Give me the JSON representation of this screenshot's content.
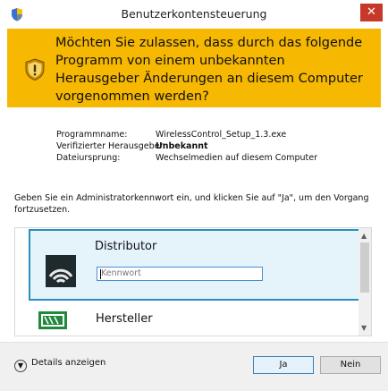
{
  "window": {
    "title": "Benutzerkontensteuerung",
    "close_glyph": "✕",
    "title_icon": "shield-icon"
  },
  "banner": {
    "text": "Möchten Sie zulassen, dass durch das folgende Programm von einem unbekannten Herausgeber Änderungen an diesem Computer vorgenommen werden?",
    "icon": "warning-shield-icon",
    "color": "#f6b800"
  },
  "details": {
    "program_label": "Programmname:",
    "program_value": "WirelessControl_Setup_1.3.exe",
    "publisher_label": "Verifizierter Herausgeber:",
    "publisher_value": "Unbekannt",
    "origin_label": "Dateiursprung:",
    "origin_value": "Wechselmedien auf diesem Computer"
  },
  "prompt": "Geben Sie ein Administratorkennwort ein, und klicken Sie auf \"Ja\", um den Vorgang fortzusetzen.",
  "accounts": {
    "selected": {
      "name": "Distributor",
      "password_placeholder": "Kennwort",
      "icon": "wifi-icon"
    },
    "other": {
      "name": "Hersteller",
      "icon": "vendor-logo-icon"
    }
  },
  "footer": {
    "details_label": "Details anzeigen",
    "yes_label": "Ja",
    "no_label": "Nein"
  },
  "colors": {
    "accent": "#2a8fbd",
    "close": "#c8382a"
  }
}
